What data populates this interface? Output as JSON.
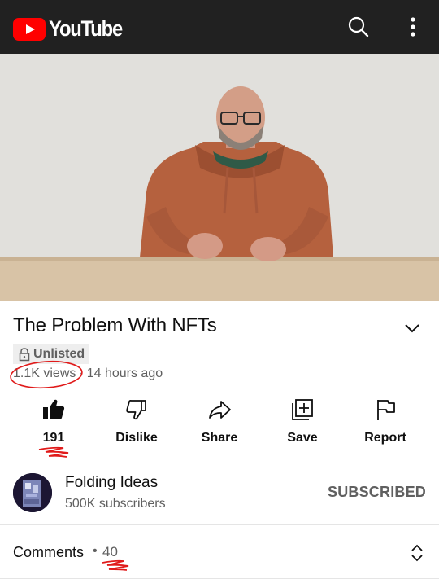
{
  "app": {
    "name": "YouTube"
  },
  "header": {
    "logo_text": "YouTube",
    "icons": [
      "search-icon",
      "more-vert-icon"
    ]
  },
  "video": {
    "title": "The Problem With NFTs",
    "privacy_badge": "Unlisted",
    "views": "1.1K views",
    "separator": "·",
    "posted": "14 hours ago"
  },
  "actions": {
    "like_count": "191",
    "dislike_label": "Dislike",
    "share_label": "Share",
    "save_label": "Save",
    "report_label": "Report"
  },
  "channel": {
    "name": "Folding Ideas",
    "subscribers": "500K subscribers",
    "subscribe_state": "SUBSCRIBED"
  },
  "comments": {
    "label": "Comments",
    "separator": "•",
    "count": "40"
  },
  "colors": {
    "topbar": "#212121",
    "brand_red": "#ff0000",
    "secondary_text": "#606060",
    "annotation_red": "#e01a1a"
  }
}
